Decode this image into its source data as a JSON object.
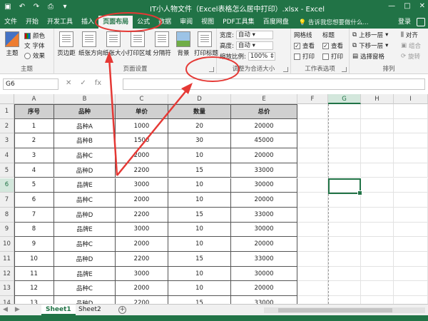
{
  "titlebar": {
    "title": "IT小人物文件（Excel表格怎么居中打印）.xlsx - Excel",
    "qat": [
      "save-icon",
      "undo-icon",
      "redo-icon",
      "print-preview-icon",
      "customize-icon"
    ],
    "controls": [
      "—",
      "□",
      "✕"
    ]
  },
  "tabs": [
    "文件",
    "开始",
    "开发工具",
    "插入",
    "页面布局",
    "公式",
    "数据",
    "审阅",
    "视图",
    "PDF工具集",
    "百度网盘"
  ],
  "tabs_active": "页面布局",
  "tell_me": "告诉我您想要做什么...",
  "login": "登录",
  "ribbon": {
    "theme": {
      "label": "主题",
      "btn": "主题",
      "colors": "颜色",
      "fonts": "字体",
      "effects": "效果"
    },
    "page_setup": {
      "label": "页面设置",
      "buttons": [
        "页边距",
        "纸张方向",
        "纸张大小",
        "打印区域",
        "分隔符",
        "背景",
        "打印标题"
      ]
    },
    "scale": {
      "label": "调整为合适大小",
      "width_label": "宽度:",
      "width_value": "自动",
      "height_label": "高度:",
      "height_value": "自动",
      "scale_label": "缩放比例:",
      "scale_value": "100%"
    },
    "sheet_options": {
      "label": "工作表选项",
      "gridlines": "网格线",
      "headings": "标题",
      "view": "查看",
      "print": "打印"
    },
    "arrange": {
      "label": "排列",
      "forward": "上移一层",
      "backward": "下移一层",
      "selection": "选择窗格",
      "align": "对齐",
      "group": "组合",
      "rotate": "旋转"
    }
  },
  "formula_bar": {
    "name_box": "G6",
    "buttons": [
      "✕",
      "✓",
      "fx"
    ],
    "formula": ""
  },
  "columns": [
    "A",
    "B",
    "C",
    "D",
    "E",
    "F",
    "G",
    "H",
    "I"
  ],
  "selected_column": "G",
  "selected_row": 6,
  "table": {
    "headers": [
      "序号",
      "品种",
      "单价",
      "数量",
      "总价"
    ],
    "rows": [
      [
        "1",
        "品种A",
        "1000",
        "20",
        "20000"
      ],
      [
        "2",
        "品种B",
        "1500",
        "30",
        "45000"
      ],
      [
        "3",
        "品种C",
        "2000",
        "10",
        "20000"
      ],
      [
        "4",
        "品种D",
        "2200",
        "15",
        "33000"
      ],
      [
        "5",
        "品牌E",
        "3000",
        "10",
        "30000"
      ],
      [
        "6",
        "品种C",
        "2000",
        "10",
        "20000"
      ],
      [
        "7",
        "品种D",
        "2200",
        "15",
        "33000"
      ],
      [
        "8",
        "品牌E",
        "3000",
        "10",
        "30000"
      ],
      [
        "9",
        "品种C",
        "2000",
        "10",
        "20000"
      ],
      [
        "10",
        "品种D",
        "2200",
        "15",
        "33000"
      ],
      [
        "11",
        "品牌E",
        "3000",
        "10",
        "30000"
      ],
      [
        "12",
        "品种C",
        "2000",
        "10",
        "20000"
      ],
      [
        "13",
        "品种D",
        "2200",
        "15",
        "33000"
      ]
    ]
  },
  "row_numbers": [
    "1",
    "2",
    "3",
    "4",
    "5",
    "6",
    "7",
    "8",
    "9",
    "10",
    "11",
    "12",
    "13",
    "14"
  ],
  "sheets": [
    "Sheet1",
    "Sheet2"
  ],
  "active_sheet": "Sheet1",
  "colors": {
    "excel_green": "#217346",
    "annotation_red": "#e53935"
  }
}
